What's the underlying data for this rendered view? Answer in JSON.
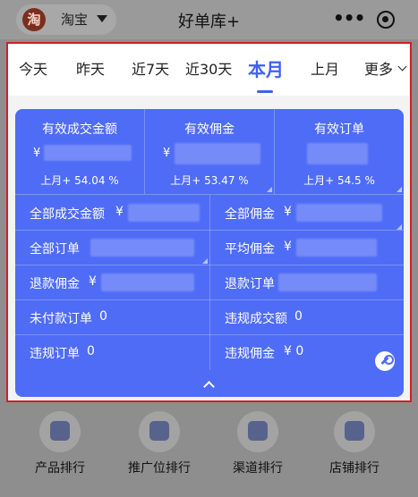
{
  "topbar": {
    "store_logo": "淘",
    "store_name": "淘宝",
    "title": "好单库+",
    "more_icon": "•••"
  },
  "tabs": [
    {
      "label": "今天"
    },
    {
      "label": "昨天"
    },
    {
      "label": "近7天"
    },
    {
      "label": "近30天"
    },
    {
      "label": "本月",
      "active": true
    },
    {
      "label": "上月"
    },
    {
      "label": "更多"
    }
  ],
  "colors": {
    "accent": "#4f6cf6",
    "frame": "#d21f25",
    "active_tab": "#3f61ef"
  },
  "metrics": [
    {
      "label": "有效成交金额",
      "currency": "¥",
      "change": "上月+ 54.04 %"
    },
    {
      "label": "有效佣金",
      "currency": "¥",
      "change": "上月+ 53.47 %"
    },
    {
      "label": "有效订单",
      "change": "上月+ 54.5 %"
    }
  ],
  "stats": {
    "total_gmv_label": "全部成交金额",
    "total_gmv_currency": "¥",
    "total_commission_label": "全部佣金",
    "total_commission_currency": "¥",
    "total_orders_label": "全部订单",
    "avg_commission_label": "平均佣金",
    "avg_commission_currency": "¥",
    "refund_commission_label": "退款佣金",
    "refund_commission_currency": "¥",
    "refund_orders_label": "退款订单",
    "unpaid_orders_label": "未付款订单",
    "unpaid_orders_value": "0",
    "violation_gmv_label": "违规成交额",
    "violation_gmv_value": "0",
    "violation_orders_label": "违规订单",
    "violation_orders_value": "0",
    "violation_commission_label": "违规佣金",
    "violation_commission_value": "¥ 0"
  },
  "bottom_nav": [
    {
      "label": "产品排行",
      "icon": "bag-icon"
    },
    {
      "label": "推广位排行",
      "icon": "pid-icon"
    },
    {
      "label": "渠道排行",
      "icon": "cube-icon"
    },
    {
      "label": "店铺排行",
      "icon": "store-icon"
    }
  ]
}
